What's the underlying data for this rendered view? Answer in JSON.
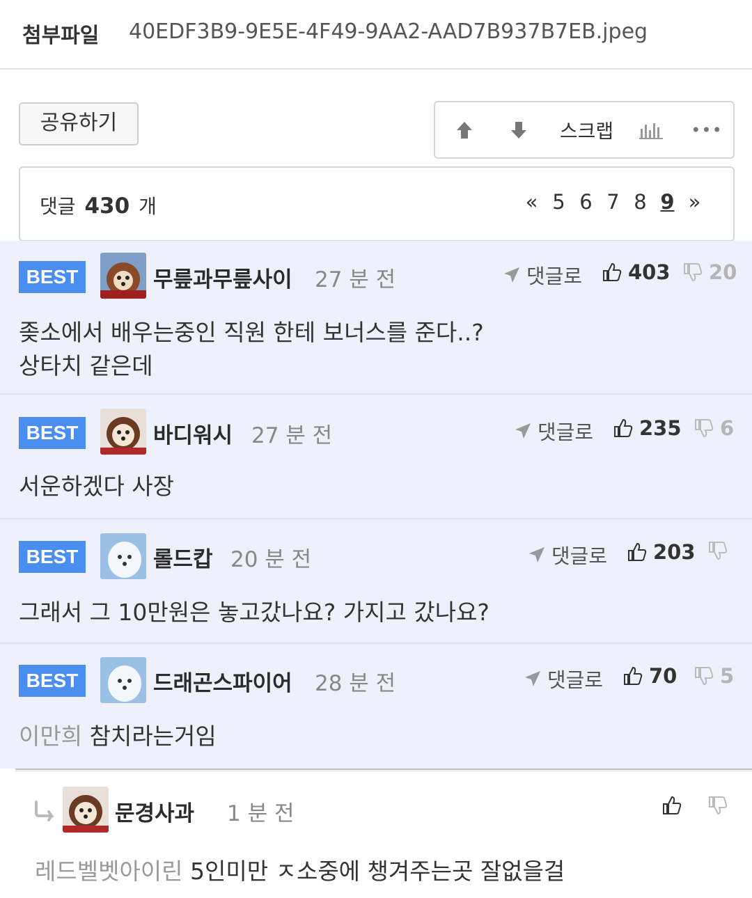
{
  "attachment": {
    "label": "첨부파일",
    "filename": "40EDF3B9-9E5E-4F49-9AA2-AAD7B937B7EB.jpeg"
  },
  "toolbar": {
    "share_label": "공유하기",
    "scrap_label": "스크랩",
    "up_icon": "up-arrow-icon",
    "down_icon": "down-arrow-icon",
    "stats_icon": "bar-chart-icon",
    "more_icon": "more-icon"
  },
  "comments_header": {
    "prefix": "댓글",
    "count": "430",
    "suffix": "개"
  },
  "pager": {
    "prev": "«",
    "pages": [
      "5",
      "6",
      "7",
      "8",
      "9"
    ],
    "current": "9",
    "next": "»"
  },
  "best_badge": "BEST",
  "reply_link_label": "댓글로",
  "best_comments": [
    {
      "nickname": "무릎과무릎사이",
      "time": "27 분 전",
      "likes": "403",
      "dislikes": "20",
      "body_lines": [
        "좆소에서 배우는중인 직원 한테 보너스를 준다..?",
        "상타치 같은데"
      ]
    },
    {
      "nickname": "바디워시",
      "time": "27 분 전",
      "likes": "235",
      "dislikes": "6",
      "body_lines": [
        "서운하겠다 사장"
      ]
    },
    {
      "nickname": "롤드캅",
      "time": "20 분 전",
      "likes": "203",
      "dislikes": "",
      "body_lines": [
        "그래서 그 10만원은 놓고갔나요? 가지고 갔나요?"
      ]
    },
    {
      "nickname": "드래곤스파이어",
      "time": "28 분 전",
      "likes": "70",
      "dislikes": "5",
      "mention": "이만희",
      "body_lines": [
        "참치라는거임"
      ]
    }
  ],
  "reply": {
    "nickname": "문경사과",
    "time": "1 분 전",
    "mention": "레드벨벳아이린",
    "body": "5인미만 ㅈ소중에 챙겨주는곳 잘없을걸"
  },
  "colors": {
    "badge": "#4a8ef0",
    "best_bg": "#eef1fb"
  }
}
